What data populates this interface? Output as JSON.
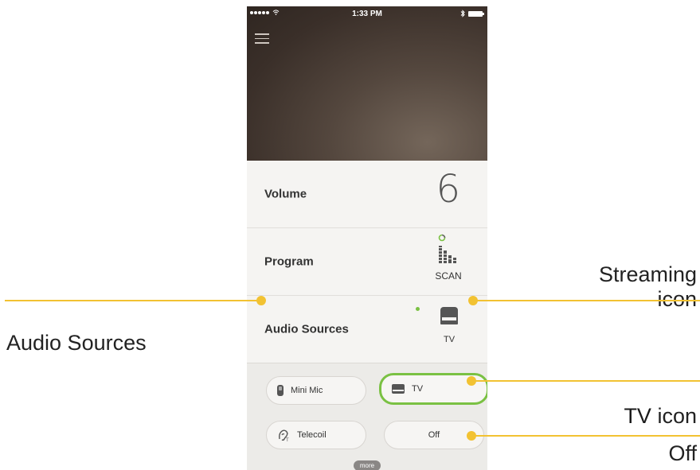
{
  "status_bar": {
    "time": "1:33 PM"
  },
  "volume": {
    "label": "Volume",
    "value": "6"
  },
  "program": {
    "label": "Program",
    "mode": "SCAN"
  },
  "audio_sources": {
    "label": "Audio Sources",
    "current": "TV"
  },
  "source_options": {
    "mini_mic": "Mini Mic",
    "tv": "TV",
    "telecoil": "Telecoil",
    "off": "Off",
    "more": "more"
  },
  "callouts": {
    "audio_sources": "Audio Sources",
    "streaming_line1": "Streaming",
    "streaming_line2": "icon",
    "tv_icon_word": "TV",
    "tv_icon_suffix": " icon",
    "off": "Off"
  },
  "colors": {
    "accent_yellow": "#f2c232",
    "active_green": "#7ac143"
  }
}
